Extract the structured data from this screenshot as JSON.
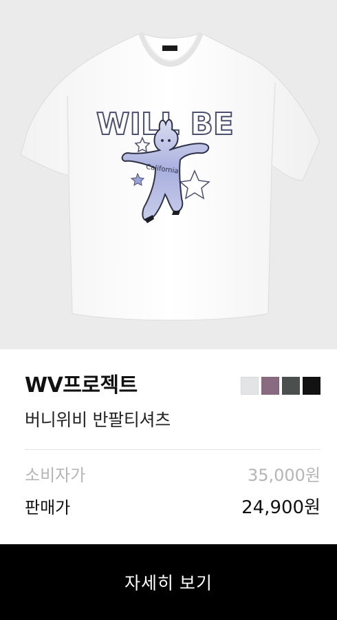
{
  "product": {
    "image_alt": "white t-shirt with rabbit graphic",
    "brand": "WV프로젝트",
    "name": "버니위비 반팔티셔츠",
    "color_options": [
      {
        "name": "light-gray",
        "hex": "#e3e4e6"
      },
      {
        "name": "mauve",
        "hex": "#8a6a80"
      },
      {
        "name": "charcoal-green",
        "hex": "#4b504e"
      },
      {
        "name": "black",
        "hex": "#121212"
      }
    ]
  },
  "graphic": {
    "wordmark": "WILL BE",
    "script_text": "California"
  },
  "pricing": {
    "retail_label": "소비자가",
    "retail_price": "35,000원",
    "sale_label": "판매가",
    "sale_price": "24,900원"
  },
  "cta": {
    "label": "자세히 보기"
  },
  "colors": {
    "image_bg": "#ebebeb",
    "cta_bg": "#000000",
    "muted_text": "#b5b5b5"
  }
}
